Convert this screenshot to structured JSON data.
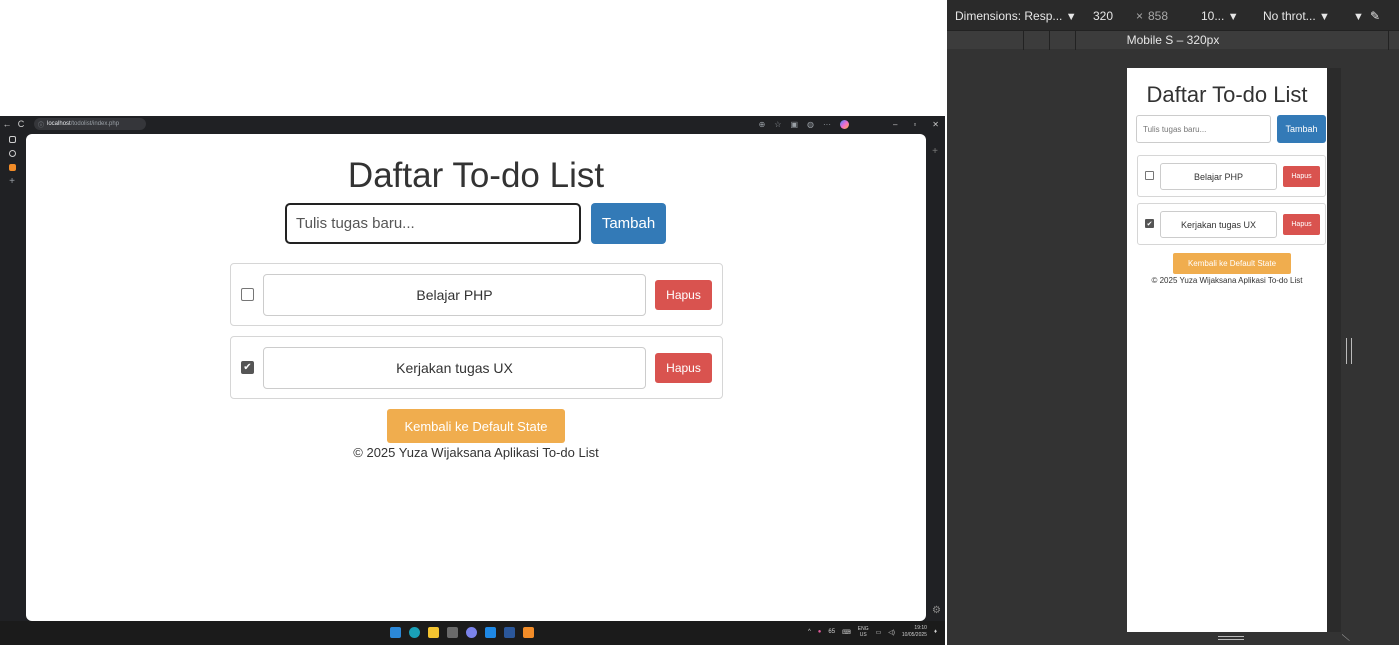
{
  "browser": {
    "url_host": "localhost",
    "url_path": "/todolist/index.php",
    "nav_icons": [
      "back-icon",
      "reload-icon",
      "info-icon"
    ],
    "toolbar_icons": [
      "zoom-icon",
      "star-icon",
      "split-screen-icon",
      "headset-icon",
      "more-icon",
      "copilot-icon"
    ],
    "window_controls": [
      "minimize-icon",
      "restore-icon",
      "close-icon"
    ]
  },
  "app": {
    "title": "Daftar To-do List",
    "input_placeholder": "Tulis tugas baru...",
    "add_label": "Tambah",
    "tasks": [
      {
        "text": "Belajar PHP",
        "checked": false,
        "delete_label": "Hapus"
      },
      {
        "text": "Kerjakan tugas UX",
        "checked": true,
        "delete_label": "Hapus"
      }
    ],
    "reset_label": "Kembali ke Default State",
    "footer": "© 2025 Yuza Wijaksana Aplikasi To-do List"
  },
  "taskbar": {
    "center_icons": [
      "windows-start-icon",
      "edge-icon",
      "file-explorer-icon",
      "store-icon",
      "chat-icon",
      "vscode-icon",
      "word-icon",
      "app-icon"
    ],
    "lang_top": "ENG",
    "lang_bottom": "US",
    "tray_number": "65",
    "time": "19:10",
    "date": "10/05/2025"
  },
  "devtools": {
    "dimensions_label": "Dimensions: Resp...",
    "width": "320",
    "times": "×",
    "height": "858",
    "zoom": "10...",
    "throttle": "No throt...",
    "device_label": "Mobile S – 320px"
  },
  "colors": {
    "primary": "#337ab7",
    "danger": "#d9534f",
    "warning": "#f0ad4e"
  }
}
